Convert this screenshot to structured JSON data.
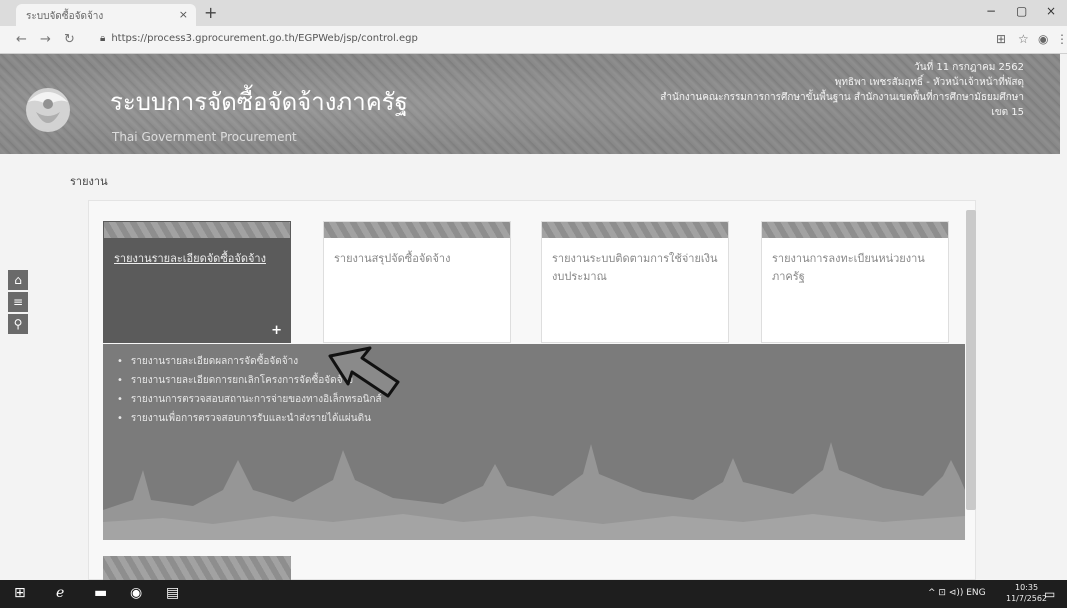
{
  "browser": {
    "tab_title": "ระบบจัดซื้อจัดจ้าง",
    "tab_close": "×",
    "new_tab": "+",
    "url": "https://process3.gprocurement.go.th/EGPWeb/jsp/control.egp",
    "window_controls": [
      "−",
      "▢",
      "×"
    ]
  },
  "header": {
    "title": "ระบบการจัดซื้อจัดจ้างภาครัฐ",
    "subtitle": "Thai Government Procurement",
    "date": "วันที่ 11 กรกฎาคม 2562",
    "user": "พุทธิพา เพชรสัมฤทธิ์ - หัวหน้าเจ้าหน้าที่พัสดุ",
    "org": "สำนักงานคณะกรรมการการศึกษาขั้นพื้นฐาน สำนักงานเขตพื้นที่การศึกษามัธยมศึกษา",
    "area": "เขต 15"
  },
  "breadcrumb": "รายงาน",
  "sidetools": [
    {
      "icon": "home-icon",
      "glyph": "⌂"
    },
    {
      "icon": "menu-icon",
      "glyph": "≡"
    },
    {
      "icon": "search-icon",
      "glyph": "⚲"
    }
  ],
  "cards": [
    {
      "label": "รายงานรายละเอียดจัดซื้อจัดจ้าง",
      "active": true,
      "plus": "+"
    },
    {
      "label": "รายงานสรุปจัดซื้อจัดจ้าง",
      "active": false
    },
    {
      "label": "รายงานระบบติดตามการใช้จ่ายเงินงบประมาณ",
      "active": false
    },
    {
      "label": "รายงานการลงทะเบียนหน่วยงานภาครัฐ",
      "active": false
    }
  ],
  "submenu": [
    "รายงานรายละเอียดผลการจัดซื้อจัดจ้าง",
    "รายงานรายละเอียดการยกเลิกโครงการจัดซื้อจัดจ้าง",
    "รายงานการตรวจสอบสถานะการจ่ายของทางอิเล็กทรอนิกส์",
    "รายงานเพื่อการตรวจสอบการรับและนำส่งรายได้แผ่นดิน"
  ],
  "taskbar": {
    "tray_text": "^ ⊡ ⊲)) ENG",
    "time": "10:35",
    "date": "11/7/2562"
  },
  "colors": {
    "header_bg": "#868686",
    "active_card": "#5b5b5b",
    "submenu_bg": "#7b7b7b",
    "taskbar": "#1e1e1e"
  }
}
